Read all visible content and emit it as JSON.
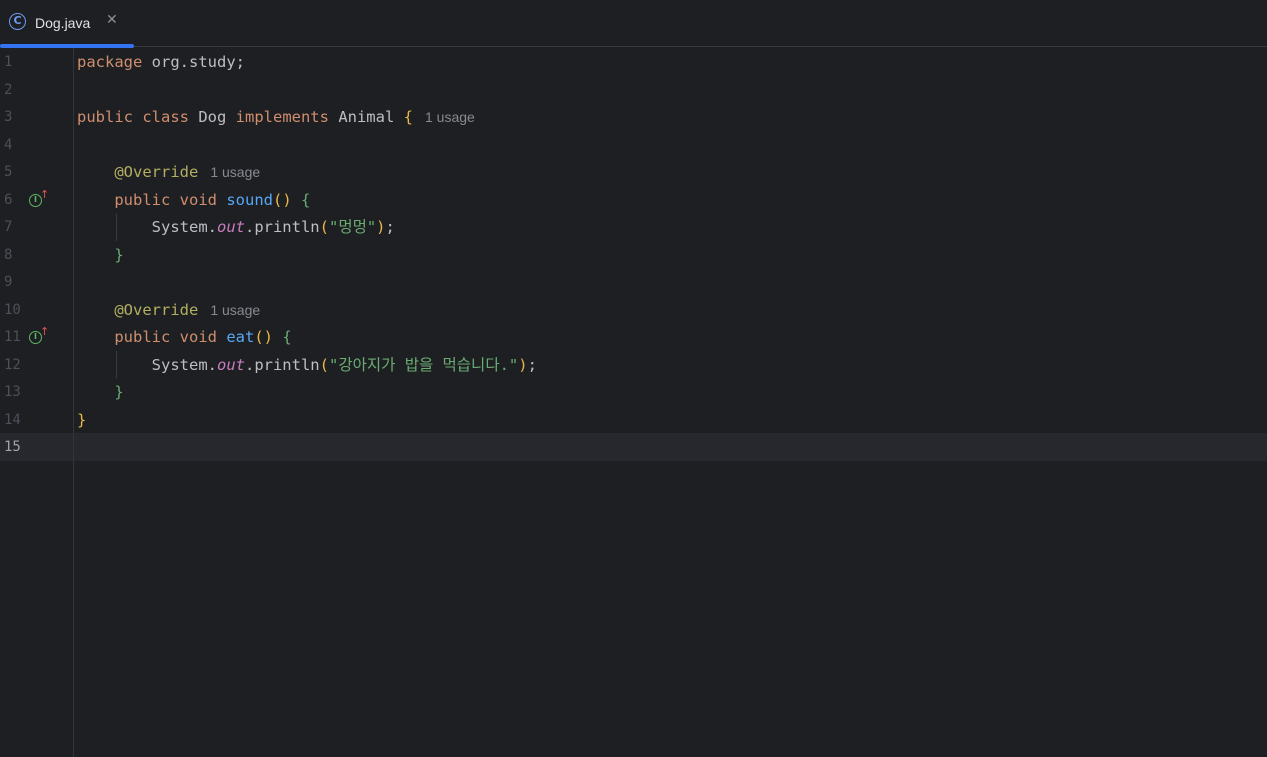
{
  "tab": {
    "icon": "class-icon",
    "icon_glyph": "C",
    "label": "Dog.java",
    "close": "✕"
  },
  "lines": [
    {
      "n": "1",
      "tokens": [
        [
          "kw",
          "package"
        ],
        [
          "ident",
          " org.study;"
        ]
      ]
    },
    {
      "n": "2",
      "tokens": []
    },
    {
      "n": "3",
      "tokens": [
        [
          "kw",
          "public class"
        ],
        [
          "ident",
          " Dog "
        ],
        [
          "kw",
          "implements"
        ],
        [
          "ident",
          " Animal "
        ],
        [
          "brace-y",
          "{"
        ]
      ],
      "hint": "1 usage"
    },
    {
      "n": "4",
      "tokens": []
    },
    {
      "n": "5",
      "tokens": [
        [
          "ident",
          "    "
        ],
        [
          "ann",
          "@Override"
        ]
      ],
      "hint": "1 usage"
    },
    {
      "n": "6",
      "tokens": [
        [
          "ident",
          "    "
        ],
        [
          "kw",
          "public void"
        ],
        [
          "ident",
          " "
        ],
        [
          "fn",
          "sound"
        ],
        [
          "brace-y",
          "()"
        ],
        [
          "ident",
          " "
        ],
        [
          "brace-g",
          "{"
        ]
      ],
      "gutter_icon": "implements-icon"
    },
    {
      "n": "7",
      "tokens": [
        [
          "ident",
          "        System."
        ],
        [
          "field",
          "out"
        ],
        [
          "ident",
          ".println"
        ],
        [
          "brace-y",
          "("
        ],
        [
          "str",
          "\"멍멍\""
        ],
        [
          "brace-y",
          ")"
        ],
        [
          "ident",
          ";"
        ]
      ]
    },
    {
      "n": "8",
      "tokens": [
        [
          "ident",
          "    "
        ],
        [
          "brace-g",
          "}"
        ]
      ]
    },
    {
      "n": "9",
      "tokens": []
    },
    {
      "n": "10",
      "tokens": [
        [
          "ident",
          "    "
        ],
        [
          "ann",
          "@Override"
        ]
      ],
      "hint": "1 usage"
    },
    {
      "n": "11",
      "tokens": [
        [
          "ident",
          "    "
        ],
        [
          "kw",
          "public void"
        ],
        [
          "ident",
          " "
        ],
        [
          "fn",
          "eat"
        ],
        [
          "brace-y",
          "()"
        ],
        [
          "ident",
          " "
        ],
        [
          "brace-g",
          "{"
        ]
      ],
      "gutter_icon": "implements-icon"
    },
    {
      "n": "12",
      "tokens": [
        [
          "ident",
          "        System."
        ],
        [
          "field",
          "out"
        ],
        [
          "ident",
          ".println"
        ],
        [
          "brace-y",
          "("
        ],
        [
          "str",
          "\"강아지가 밥을 먹습니다.\""
        ],
        [
          "brace-y",
          ")"
        ],
        [
          "ident",
          ";"
        ]
      ]
    },
    {
      "n": "13",
      "tokens": [
        [
          "ident",
          "    "
        ],
        [
          "brace-g",
          "}"
        ]
      ]
    },
    {
      "n": "14",
      "tokens": [
        [
          "brace-y",
          "}"
        ]
      ]
    },
    {
      "n": "15",
      "tokens": [],
      "active": true
    }
  ],
  "gutter_icon_glyph": "I",
  "gutter_icon_arrow": "↑"
}
